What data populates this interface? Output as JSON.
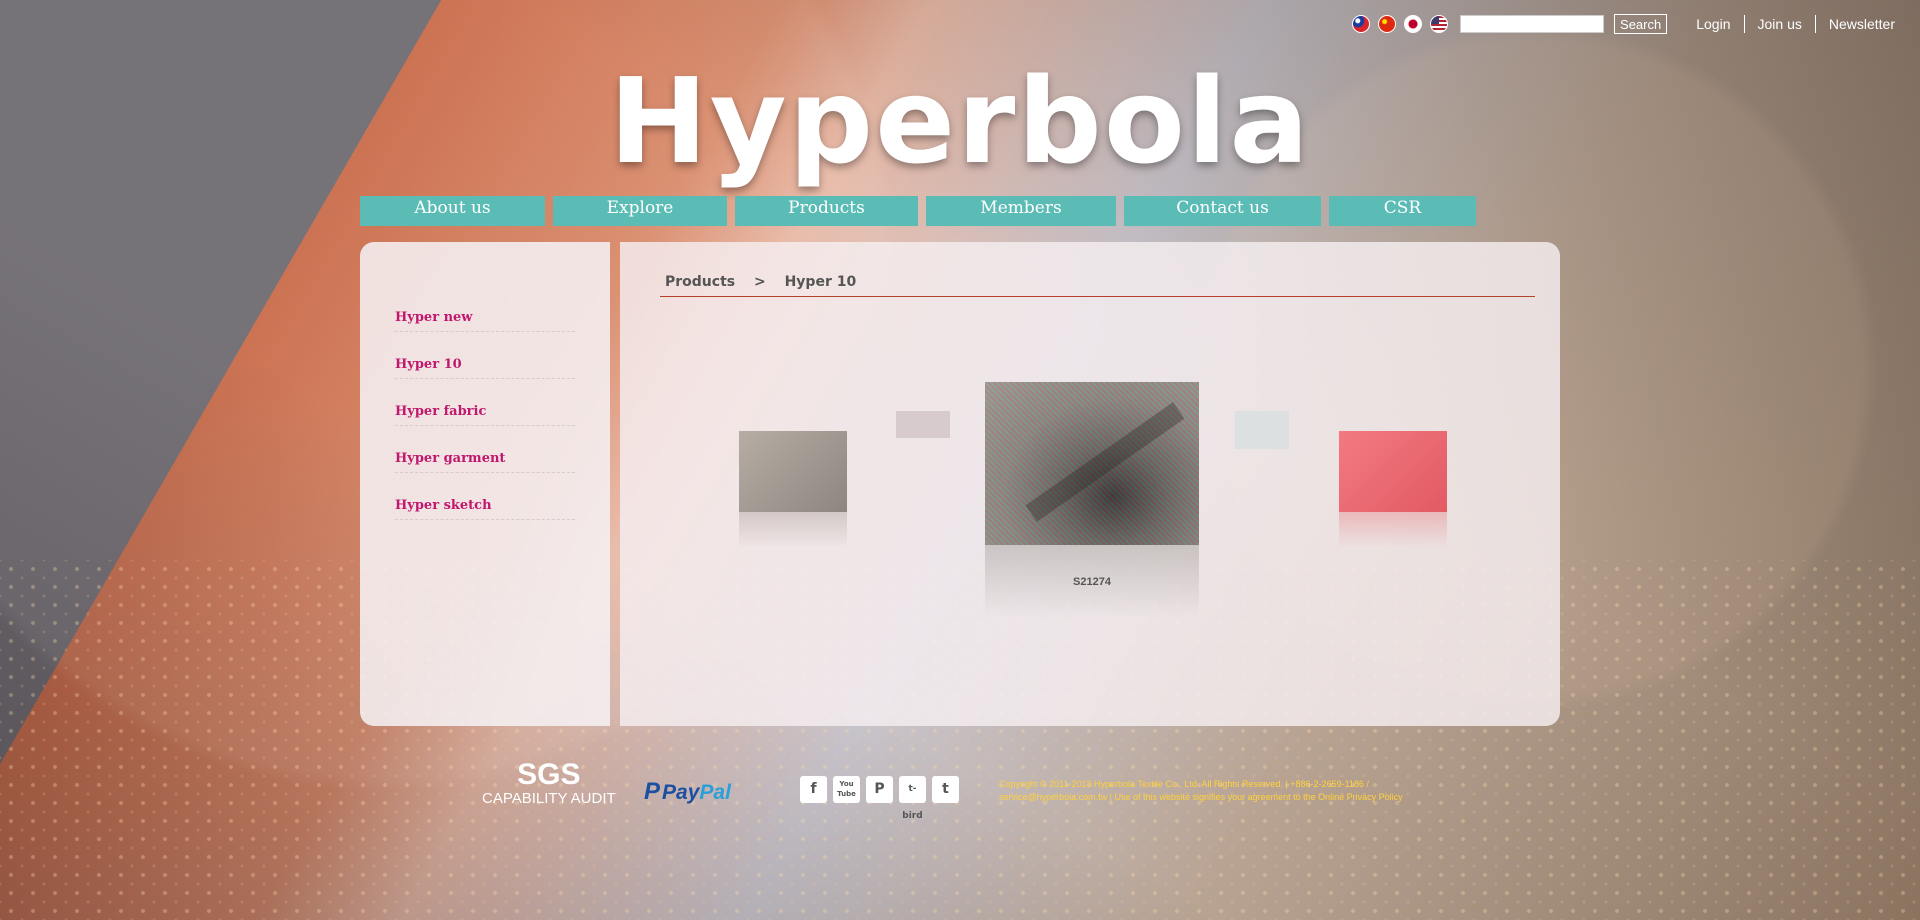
{
  "top": {
    "flags": [
      {
        "name": "taiwan-flag-icon"
      },
      {
        "name": "china-flag-icon"
      },
      {
        "name": "japan-flag-icon"
      },
      {
        "name": "usa-flag-icon"
      }
    ],
    "search_value": "",
    "search_button": "Search",
    "links": [
      "Login",
      "Join us",
      "Newsletter"
    ]
  },
  "logo": "Hyperbola",
  "nav": [
    "About us",
    "Explore",
    "Products",
    "Members",
    "Contact us",
    "CSR"
  ],
  "sidebar": {
    "items": [
      "Hyper new",
      "Hyper 10",
      "Hyper fabric",
      "Hyper garment",
      "Hyper sketch"
    ]
  },
  "breadcrumb": {
    "root": "Products",
    "separator": ">",
    "current": "Hyper 10"
  },
  "carousel": {
    "center_caption": "S21274"
  },
  "footer": {
    "sgs_title": "SGS",
    "sgs_subtitle": "CAPABILITY AUDIT",
    "paypal_p": "P",
    "paypal_pay": "Pay",
    "paypal_pal": "Pal",
    "social": [
      "f",
      "You Tube",
      "P",
      "t-bird",
      "t"
    ],
    "copyright": "Copyright © 2011-2013 Hyperbola Textile Co., Ltd. All Rights Reserved. | +886-2-2659-1186 / service@hyperbola.com.tw | Use of this website signifies your agreement to the Online Privacy Policy"
  },
  "colors": {
    "nav_bg": "#5bbcb6",
    "sidebar_link": "#c0186e",
    "breadcrumb_rule": "#b3412b",
    "copyright_text": "#ffd23a"
  }
}
